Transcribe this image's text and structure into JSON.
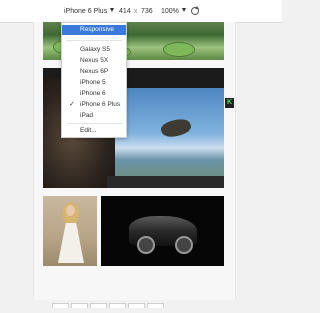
{
  "toolbar": {
    "device": "iPhone 6 Plus",
    "width": "414",
    "separator": "x",
    "height": "736",
    "zoom": "100%"
  },
  "device_menu": {
    "items": [
      {
        "label": "Responsive",
        "selected": true
      },
      {
        "label": "Galaxy S5"
      },
      {
        "label": "Nexus 5X"
      },
      {
        "label": "Nexus 6P"
      },
      {
        "label": "iPhone 5"
      },
      {
        "label": "iPhone 6"
      },
      {
        "label": "iPhone 6 Plus",
        "checked": true
      },
      {
        "label": "iPad"
      },
      {
        "label": "Edit..."
      }
    ],
    "check_mark": "✓"
  },
  "side_tag": "K",
  "colors": {
    "menu_highlight": "#3879d9",
    "side_tag_text": "#4cd964"
  }
}
